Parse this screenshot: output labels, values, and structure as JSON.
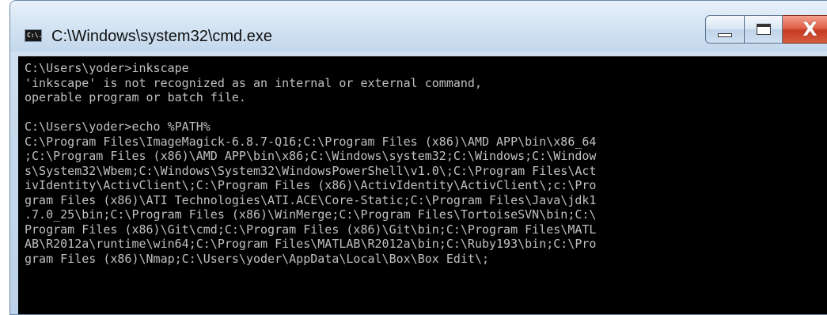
{
  "window": {
    "title": "C:\\Windows\\system32\\cmd.exe",
    "icon_text": "C:\\."
  },
  "caption_buttons": {
    "minimize": "minimize-icon",
    "maximize": "maximize-icon",
    "close": "close-icon",
    "close_glyph": "X"
  },
  "console": {
    "lines": [
      "C:\\Users\\yoder>inkscape",
      "'inkscape' is not recognized as an internal or external command,",
      "operable program or batch file.",
      "",
      "C:\\Users\\yoder>echo %PATH%",
      "C:\\Program Files\\ImageMagick-6.8.7-Q16;C:\\Program Files (x86)\\AMD APP\\bin\\x86_64",
      ";C:\\Program Files (x86)\\AMD APP\\bin\\x86;C:\\Windows\\system32;C:\\Windows;C:\\Window",
      "s\\System32\\Wbem;C:\\Windows\\System32\\WindowsPowerShell\\v1.0\\;C:\\Program Files\\Act",
      "ivIdentity\\ActivClient\\;C:\\Program Files (x86)\\ActivIdentity\\ActivClient\\;c:\\Pro",
      "gram Files (x86)\\ATI Technologies\\ATI.ACE\\Core-Static;C:\\Program Files\\Java\\jdk1",
      ".7.0_25\\bin;C:\\Program Files (x86)\\WinMerge;C:\\Program Files\\TortoiseSVN\\bin;C:\\",
      "Program Files (x86)\\Git\\cmd;C:\\Program Files (x86)\\Git\\bin;C:\\Program Files\\MATL",
      "AB\\R2012a\\runtime\\win64;C:\\Program Files\\MATLAB\\R2012a\\bin;C:\\Ruby193\\bin;C:\\Pro",
      "gram Files (x86)\\Nmap;C:\\Users\\yoder\\AppData\\Local\\Box\\Box Edit\\;"
    ]
  },
  "colors": {
    "console_bg": "#000000",
    "console_fg": "#c0c0c0",
    "close_button": "#c53a22"
  }
}
